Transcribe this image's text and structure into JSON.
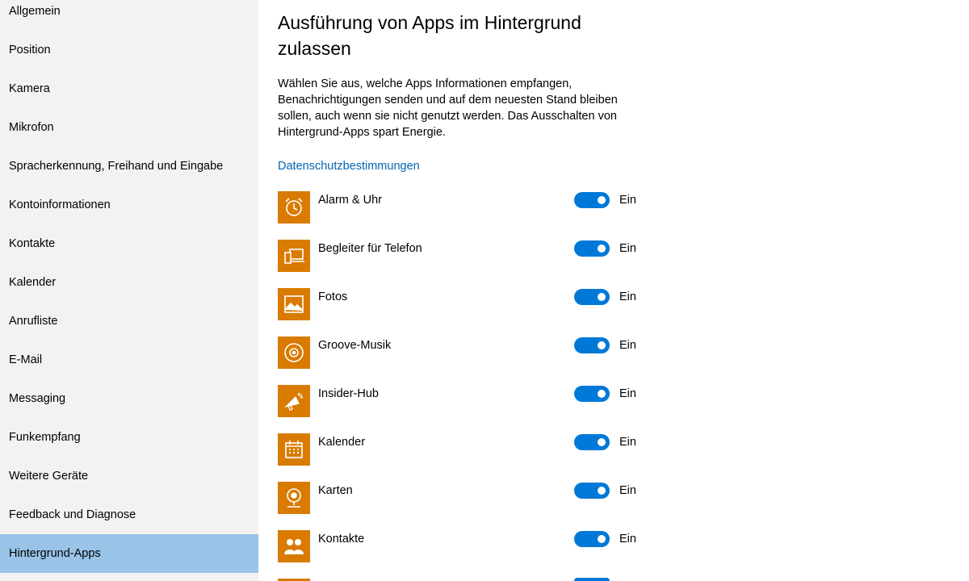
{
  "sidebar": {
    "items": [
      {
        "label": "Allgemein"
      },
      {
        "label": "Position"
      },
      {
        "label": "Kamera"
      },
      {
        "label": "Mikrofon"
      },
      {
        "label": "Spracherkennung, Freihand und Eingabe"
      },
      {
        "label": "Kontoinformationen"
      },
      {
        "label": "Kontakte"
      },
      {
        "label": "Kalender"
      },
      {
        "label": "Anrufliste"
      },
      {
        "label": "E-Mail"
      },
      {
        "label": "Messaging"
      },
      {
        "label": "Funkempfang"
      },
      {
        "label": "Weitere Geräte"
      },
      {
        "label": "Feedback und Diagnose"
      },
      {
        "label": "Hintergrund-Apps",
        "active": true
      }
    ]
  },
  "main": {
    "title": "Ausführung von Apps im Hintergrund zulassen",
    "description": "Wählen Sie aus, welche Apps Informationen empfangen, Benachrichtigungen senden und auf dem neuesten Stand bleiben sollen, auch wenn sie nicht genutzt werden. Das Ausschalten von Hintergrund-Apps spart Energie.",
    "privacy_link": "Datenschutzbestimmungen",
    "apps": [
      {
        "name": "Alarm & Uhr",
        "icon": "alarm-clock-icon",
        "state": "Ein"
      },
      {
        "name": "Begleiter für Telefon",
        "icon": "phone-companion-icon",
        "state": "Ein"
      },
      {
        "name": "Fotos",
        "icon": "photos-icon",
        "state": "Ein"
      },
      {
        "name": "Groove-Musik",
        "icon": "groove-music-icon",
        "state": "Ein"
      },
      {
        "name": "Insider-Hub",
        "icon": "megaphone-icon",
        "state": "Ein"
      },
      {
        "name": "Kalender",
        "icon": "calendar-icon",
        "state": "Ein"
      },
      {
        "name": "Karten",
        "icon": "maps-icon",
        "state": "Ein"
      },
      {
        "name": "Kontakte",
        "icon": "people-icon",
        "state": "Ein"
      }
    ]
  },
  "colors": {
    "accent": "#0078d7",
    "link": "#0063b1",
    "app_tile": "#d97b00",
    "sidebar_bg": "#f2f2f2",
    "sidebar_active": "#99c4e8"
  }
}
